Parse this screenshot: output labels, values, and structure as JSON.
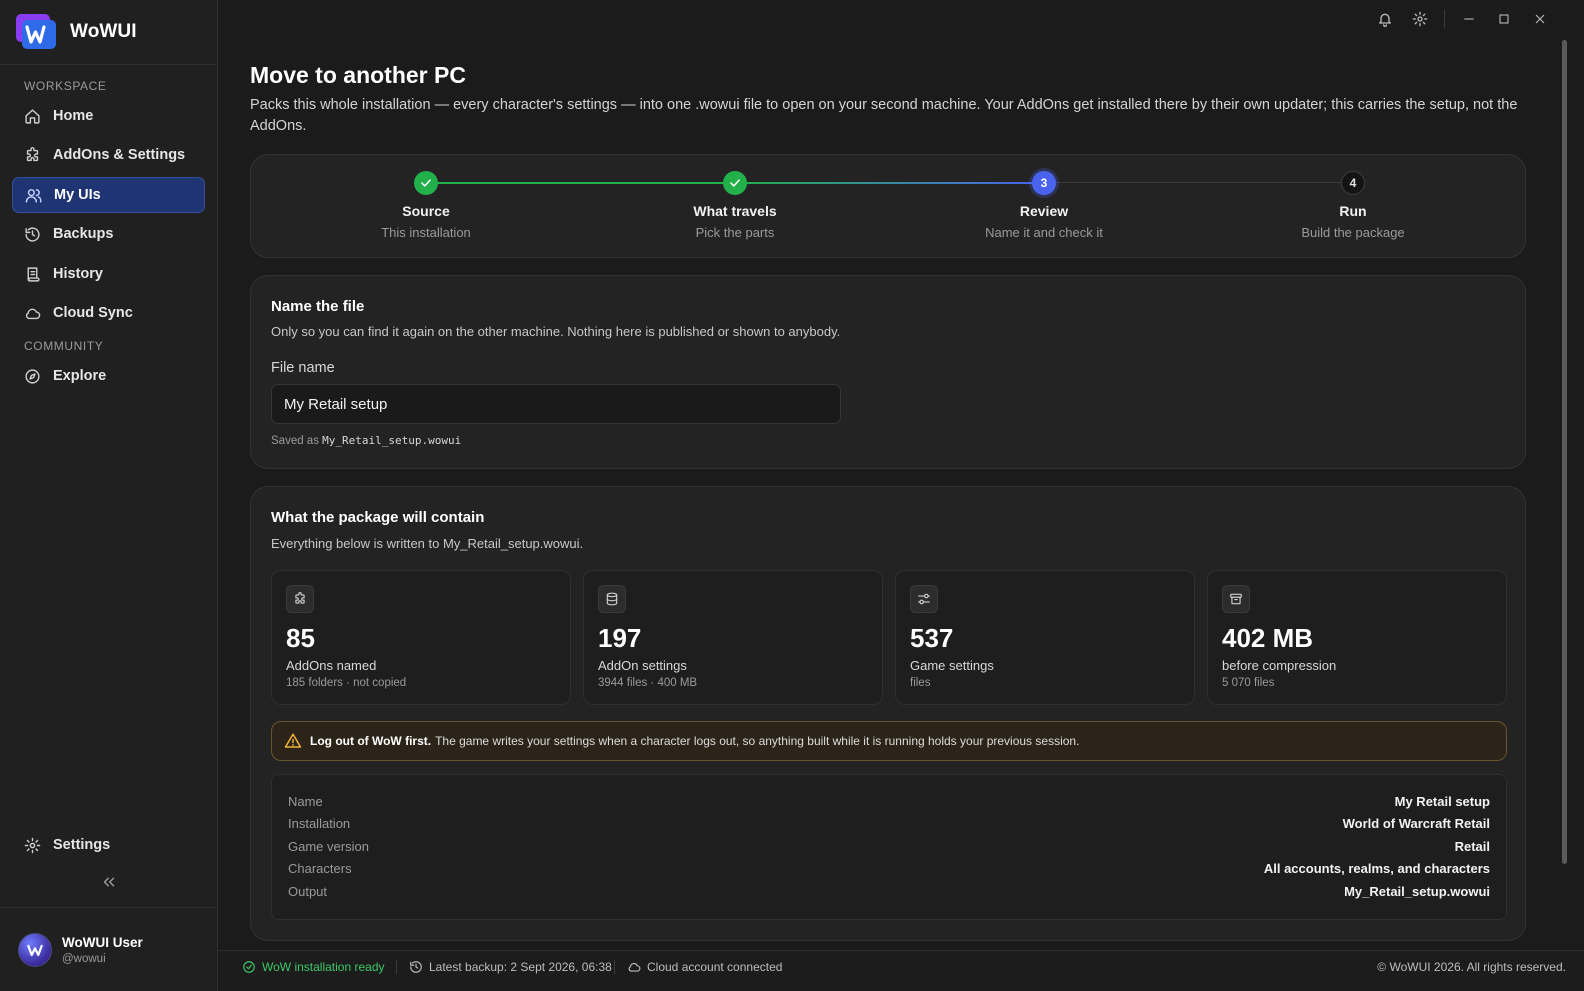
{
  "app": {
    "name": "WoWUI"
  },
  "sidebar": {
    "sections": [
      {
        "label": "WORKSPACE"
      },
      {
        "label": "COMMUNITY"
      }
    ],
    "items": [
      {
        "label": "Home",
        "icon": "home-icon"
      },
      {
        "label": "AddOns & Settings",
        "icon": "puzzle-icon"
      },
      {
        "label": "My UIs",
        "icon": "users-icon",
        "active": true
      },
      {
        "label": "Backups",
        "icon": "history-icon"
      },
      {
        "label": "History",
        "icon": "scroll-icon"
      },
      {
        "label": "Cloud Sync",
        "icon": "cloud-icon"
      },
      {
        "label": "Explore",
        "icon": "compass-icon"
      }
    ],
    "settings_label": "Settings",
    "user": {
      "name": "WoWUI User",
      "handle": "@wowui"
    }
  },
  "page": {
    "title": "Move to another PC",
    "description": "Packs this whole installation — every character's settings — into one .wowui file to open on your second machine. Your AddOns get installed there by their own updater; this carries the setup, not the AddOns."
  },
  "stepper": {
    "steps": [
      {
        "number": "1",
        "title": "Source",
        "subtitle": "This installation",
        "state": "done"
      },
      {
        "number": "2",
        "title": "What travels",
        "subtitle": "Pick the parts",
        "state": "done"
      },
      {
        "number": "3",
        "title": "Review",
        "subtitle": "Name it and check it",
        "state": "current"
      },
      {
        "number": "4",
        "title": "Run",
        "subtitle": "Build the package",
        "state": "todo"
      }
    ]
  },
  "name_card": {
    "title": "Name the file",
    "subtitle": "Only so you can find it again on the other machine. Nothing here is published or shown to anybody.",
    "field_label": "File name",
    "field_value": "My Retail setup",
    "saved_as_prefix": "Saved as",
    "saved_as_file": "My_Retail_setup.wowui"
  },
  "package": {
    "title": "What the package will contain",
    "subtitle": "Everything below is written to My_Retail_setup.wowui.",
    "stats": [
      {
        "value": "85",
        "label": "AddOns named",
        "sub": "185 folders · not copied",
        "icon": "puzzle-icon"
      },
      {
        "value": "197",
        "label": "AddOn settings",
        "sub": "3944 files · 400 MB",
        "icon": "database-icon"
      },
      {
        "value": "537",
        "label": "Game settings",
        "sub": "files",
        "icon": "sliders-icon"
      },
      {
        "value": "402 MB",
        "label": "before compression",
        "sub": "5 070 files",
        "icon": "archive-icon"
      }
    ],
    "warning": {
      "bold": "Log out of WoW first.",
      "text": "The game writes your settings when a character logs out, so anything built while it is running holds your previous session."
    },
    "summary": [
      {
        "key": "Name",
        "value": "My Retail setup"
      },
      {
        "key": "Installation",
        "value": "World of Warcraft Retail"
      },
      {
        "key": "Game version",
        "value": "Retail"
      },
      {
        "key": "Characters",
        "value": "All accounts, realms, and characters"
      },
      {
        "key": "Output",
        "value": "My_Retail_setup.wowui"
      }
    ]
  },
  "statusbar": {
    "installation": "WoW installation ready",
    "backup": "Latest backup: 2 Sept 2026, 06:38",
    "cloud": "Cloud account connected",
    "copyright": "© WoWUI 2026. All rights reserved."
  },
  "colors": {
    "accent": "#4a63ee",
    "success": "#22b04b",
    "warning": "#f0b43c",
    "active_nav": "#1f3473"
  }
}
